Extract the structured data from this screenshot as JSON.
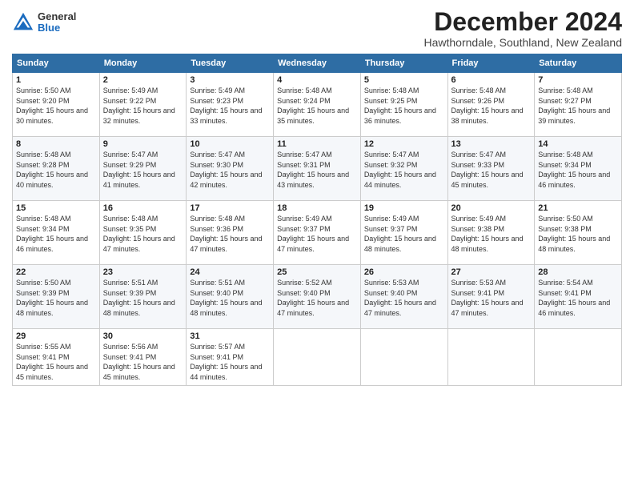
{
  "header": {
    "logo_general": "General",
    "logo_blue": "Blue",
    "month_title": "December 2024",
    "location": "Hawthorndale, Southland, New Zealand"
  },
  "days_of_week": [
    "Sunday",
    "Monday",
    "Tuesday",
    "Wednesday",
    "Thursday",
    "Friday",
    "Saturday"
  ],
  "weeks": [
    [
      {
        "day": "1",
        "sunrise": "5:50 AM",
        "sunset": "9:20 PM",
        "daylight": "15 hours and 30 minutes."
      },
      {
        "day": "2",
        "sunrise": "5:49 AM",
        "sunset": "9:22 PM",
        "daylight": "15 hours and 32 minutes."
      },
      {
        "day": "3",
        "sunrise": "5:49 AM",
        "sunset": "9:23 PM",
        "daylight": "15 hours and 33 minutes."
      },
      {
        "day": "4",
        "sunrise": "5:48 AM",
        "sunset": "9:24 PM",
        "daylight": "15 hours and 35 minutes."
      },
      {
        "day": "5",
        "sunrise": "5:48 AM",
        "sunset": "9:25 PM",
        "daylight": "15 hours and 36 minutes."
      },
      {
        "day": "6",
        "sunrise": "5:48 AM",
        "sunset": "9:26 PM",
        "daylight": "15 hours and 38 minutes."
      },
      {
        "day": "7",
        "sunrise": "5:48 AM",
        "sunset": "9:27 PM",
        "daylight": "15 hours and 39 minutes."
      }
    ],
    [
      {
        "day": "8",
        "sunrise": "5:48 AM",
        "sunset": "9:28 PM",
        "daylight": "15 hours and 40 minutes."
      },
      {
        "day": "9",
        "sunrise": "5:47 AM",
        "sunset": "9:29 PM",
        "daylight": "15 hours and 41 minutes."
      },
      {
        "day": "10",
        "sunrise": "5:47 AM",
        "sunset": "9:30 PM",
        "daylight": "15 hours and 42 minutes."
      },
      {
        "day": "11",
        "sunrise": "5:47 AM",
        "sunset": "9:31 PM",
        "daylight": "15 hours and 43 minutes."
      },
      {
        "day": "12",
        "sunrise": "5:47 AM",
        "sunset": "9:32 PM",
        "daylight": "15 hours and 44 minutes."
      },
      {
        "day": "13",
        "sunrise": "5:47 AM",
        "sunset": "9:33 PM",
        "daylight": "15 hours and 45 minutes."
      },
      {
        "day": "14",
        "sunrise": "5:48 AM",
        "sunset": "9:34 PM",
        "daylight": "15 hours and 46 minutes."
      }
    ],
    [
      {
        "day": "15",
        "sunrise": "5:48 AM",
        "sunset": "9:34 PM",
        "daylight": "15 hours and 46 minutes."
      },
      {
        "day": "16",
        "sunrise": "5:48 AM",
        "sunset": "9:35 PM",
        "daylight": "15 hours and 47 minutes."
      },
      {
        "day": "17",
        "sunrise": "5:48 AM",
        "sunset": "9:36 PM",
        "daylight": "15 hours and 47 minutes."
      },
      {
        "day": "18",
        "sunrise": "5:49 AM",
        "sunset": "9:37 PM",
        "daylight": "15 hours and 47 minutes."
      },
      {
        "day": "19",
        "sunrise": "5:49 AM",
        "sunset": "9:37 PM",
        "daylight": "15 hours and 48 minutes."
      },
      {
        "day": "20",
        "sunrise": "5:49 AM",
        "sunset": "9:38 PM",
        "daylight": "15 hours and 48 minutes."
      },
      {
        "day": "21",
        "sunrise": "5:50 AM",
        "sunset": "9:38 PM",
        "daylight": "15 hours and 48 minutes."
      }
    ],
    [
      {
        "day": "22",
        "sunrise": "5:50 AM",
        "sunset": "9:39 PM",
        "daylight": "15 hours and 48 minutes."
      },
      {
        "day": "23",
        "sunrise": "5:51 AM",
        "sunset": "9:39 PM",
        "daylight": "15 hours and 48 minutes."
      },
      {
        "day": "24",
        "sunrise": "5:51 AM",
        "sunset": "9:40 PM",
        "daylight": "15 hours and 48 minutes."
      },
      {
        "day": "25",
        "sunrise": "5:52 AM",
        "sunset": "9:40 PM",
        "daylight": "15 hours and 47 minutes."
      },
      {
        "day": "26",
        "sunrise": "5:53 AM",
        "sunset": "9:40 PM",
        "daylight": "15 hours and 47 minutes."
      },
      {
        "day": "27",
        "sunrise": "5:53 AM",
        "sunset": "9:41 PM",
        "daylight": "15 hours and 47 minutes."
      },
      {
        "day": "28",
        "sunrise": "5:54 AM",
        "sunset": "9:41 PM",
        "daylight": "15 hours and 46 minutes."
      }
    ],
    [
      {
        "day": "29",
        "sunrise": "5:55 AM",
        "sunset": "9:41 PM",
        "daylight": "15 hours and 45 minutes."
      },
      {
        "day": "30",
        "sunrise": "5:56 AM",
        "sunset": "9:41 PM",
        "daylight": "15 hours and 45 minutes."
      },
      {
        "day": "31",
        "sunrise": "5:57 AM",
        "sunset": "9:41 PM",
        "daylight": "15 hours and 44 minutes."
      },
      null,
      null,
      null,
      null
    ]
  ]
}
